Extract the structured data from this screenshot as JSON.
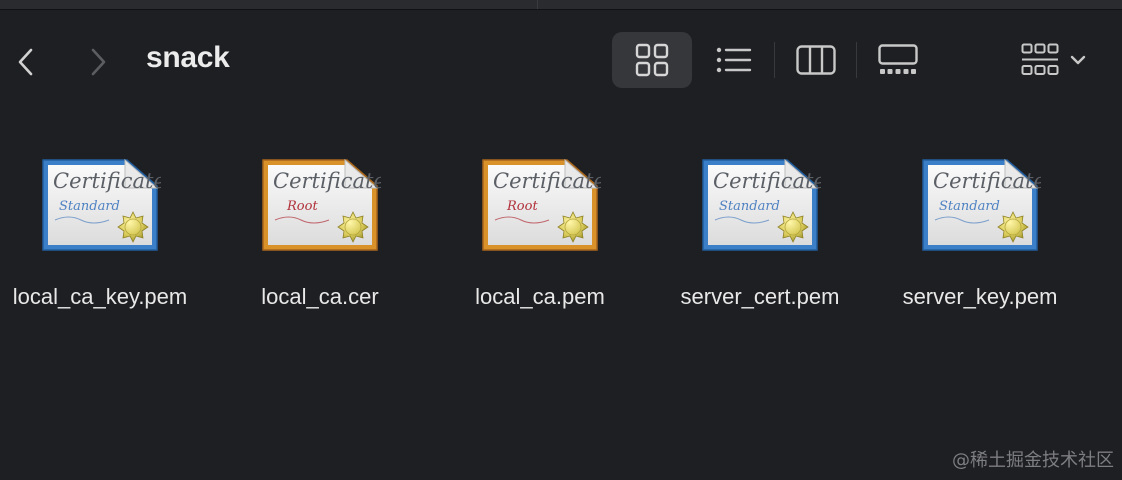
{
  "window": {
    "title": "snack"
  },
  "toolbar": {
    "back_icon": "chevron-left-icon",
    "forward_icon": "chevron-right-icon",
    "views": [
      {
        "name": "icon-view",
        "icon": "grid-icon",
        "active": true
      },
      {
        "name": "list-view",
        "icon": "list-icon",
        "active": false
      },
      {
        "name": "column-view",
        "icon": "columns-icon",
        "active": false
      },
      {
        "name": "gallery-view",
        "icon": "gallery-icon",
        "active": false
      }
    ],
    "group_icon": "group-grid-icon",
    "group_chevron": "chevron-down-icon"
  },
  "files": [
    {
      "name": "local_ca_key.pem",
      "kind": "standard"
    },
    {
      "name": "local_ca.cer",
      "kind": "root"
    },
    {
      "name": "local_ca.pem",
      "kind": "root"
    },
    {
      "name": "server_cert.pem",
      "kind": "standard"
    },
    {
      "name": "server_key.pem",
      "kind": "standard"
    }
  ],
  "certificate_icon": {
    "heading": "Certificate",
    "standard_label": "Standard",
    "root_label": "Root"
  },
  "colors": {
    "background": "#1e1f22",
    "standard_frame": "#3b7fc8",
    "root_frame": "#d9912a",
    "seal": "#d8cb5a"
  },
  "watermark": "@稀土掘金技术社区"
}
